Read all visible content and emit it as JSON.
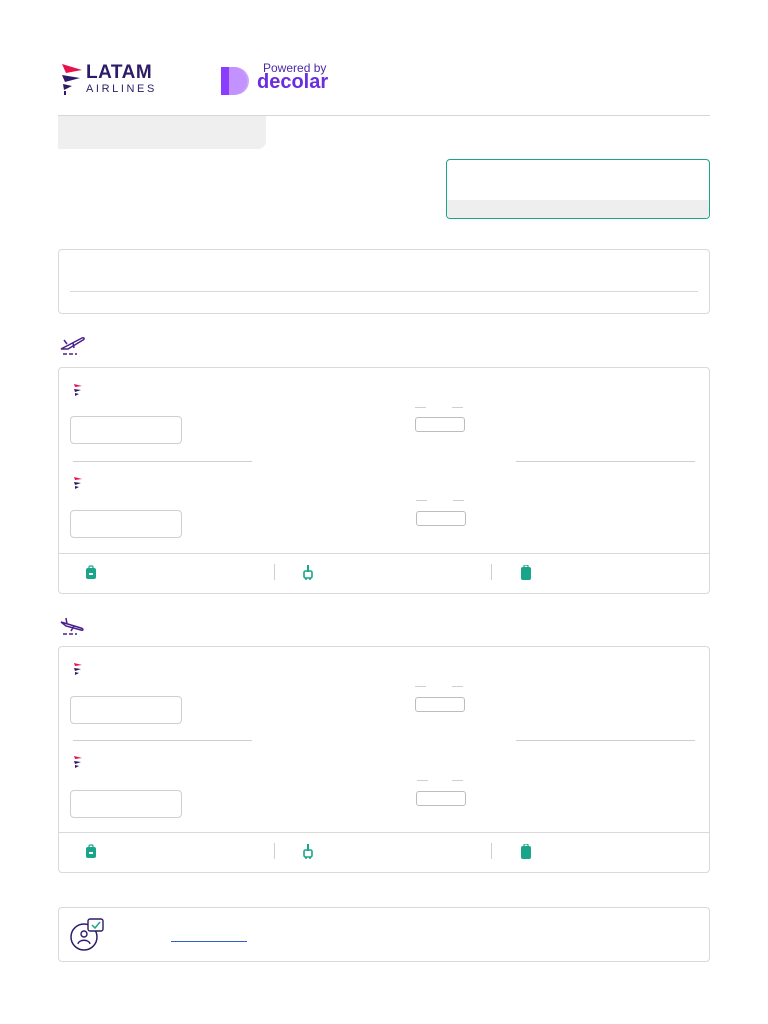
{
  "header": {
    "brand": {
      "line1": "LATAM",
      "line2": "AIRLINES"
    },
    "partner": {
      "powered": "Powered by",
      "name": "decolar"
    }
  },
  "icons": {
    "outbound": "plane-takeoff-icon",
    "inbound": "plane-landing-icon",
    "personal_item": "backpack-icon",
    "carry_on": "trolley-bag-icon",
    "checked_bag": "suitcase-icon",
    "support": "agent-chat-icon"
  },
  "colors": {
    "brand": "#2d1b68",
    "accent": "#6a2de0",
    "green": "#1aa58a",
    "link": "#2f5fd0"
  }
}
